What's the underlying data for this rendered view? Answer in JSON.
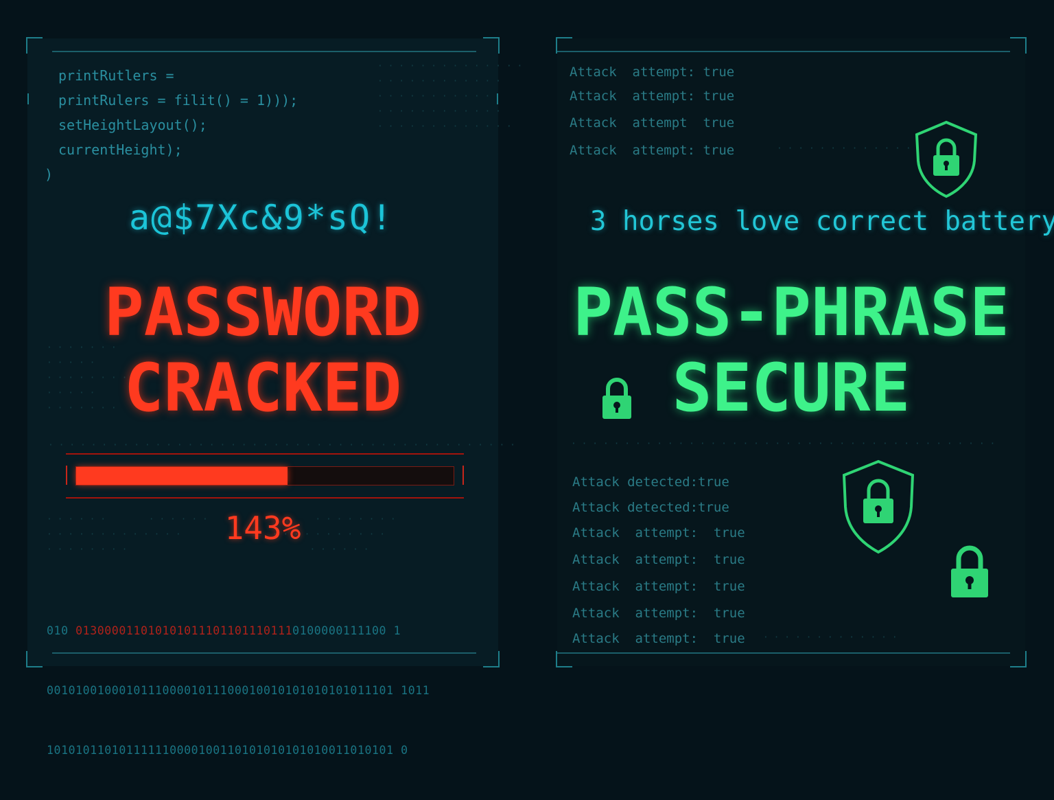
{
  "left_panel": {
    "code_lines": [
      "printRutlers =",
      "printRulers = filit() = 1)));",
      "setHeightLayout();",
      "currentHeight);"
    ],
    "code_prefix": ")",
    "password_text": "a@$7Xc&9*sQ!",
    "title_line1": "PASSWORD",
    "title_line2": "CRACKED",
    "progress_percent": 143,
    "progress_fill_fraction": 0.56,
    "progress_label": "143%",
    "binary_rows": [
      "010 0130000110101010111011011101110100000111100 1",
      "001010010001011100001011100010010101010101011101 1011",
      "101010110101111110000100110101010101010011010101 0"
    ],
    "colors": {
      "danger": "#ff3a1f",
      "cyan": "#1cc4d8"
    }
  },
  "right_panel": {
    "attack_top": [
      "Attack  attempt: true",
      "Attack  attempt: true",
      "Attack  attempt  true",
      "Attack  attempt: true"
    ],
    "phrase_text": "3 horses love correct battery",
    "title_line1": "PASS-PHRASE",
    "title_line2": "SECURE",
    "attack_bottom": [
      "Attack detected:true",
      "Attack detected:true",
      "Attack  attempt:  true",
      "Attack  attempt:  true",
      "Attack  attempt:  true",
      "Attack  attempt:  true",
      "Attack  attempt:  true"
    ],
    "icons": [
      "shield-lock-icon",
      "padlock-icon",
      "shield-lock-icon",
      "padlock-icon"
    ],
    "colors": {
      "secure": "#3ef28a"
    }
  }
}
